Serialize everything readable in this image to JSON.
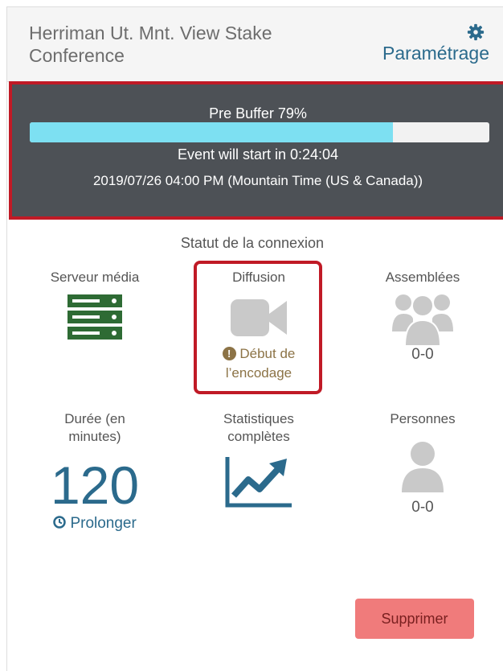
{
  "header": {
    "title": "Herriman Ut. Mnt. View Stake Conference",
    "settings_label": "Paramétrage",
    "settings_icon": "gear-icon"
  },
  "status": {
    "prebuffer_label": "Pre Buffer 79%",
    "prebuffer_percent": 79,
    "countdown": "Event will start in 0:24:04",
    "datetime": "2019/07/26 04:00 PM (Mountain Time (US & Canada))"
  },
  "connection": {
    "title": "Statut de la connexion",
    "media_server": {
      "label": "Serveur média",
      "icon": "server-icon"
    },
    "diffusion": {
      "label": "Diffusion",
      "icon": "video-camera-icon",
      "status_line1": "Début de",
      "status_line2": "l’encodage",
      "status_icon": "exclamation-circle-icon"
    },
    "assemblies": {
      "label": "Assemblées",
      "icon": "users-icon",
      "count": "0-0"
    }
  },
  "stats": {
    "duration_label_line1": "Durée (en",
    "duration_label_line2": "minutes)",
    "duration_value": "120",
    "extend_label": "Prolonger",
    "extend_icon": "clock-icon",
    "full_stats_line1": "Statistiques",
    "full_stats_line2": "complètes",
    "full_stats_icon": "line-chart-icon",
    "persons_label": "Personnes",
    "persons_icon": "user-icon",
    "persons_count": "0-0"
  },
  "actions": {
    "delete_label": "Supprimer"
  },
  "colors": {
    "accent": "#2b6a8c",
    "alert_border": "#c01a26",
    "panel_bg": "#4d5156",
    "progress_fill": "#7de0f2",
    "server_green": "#2e6b34",
    "warning_text": "#8c7346",
    "delete_button": "#f07b7b"
  }
}
